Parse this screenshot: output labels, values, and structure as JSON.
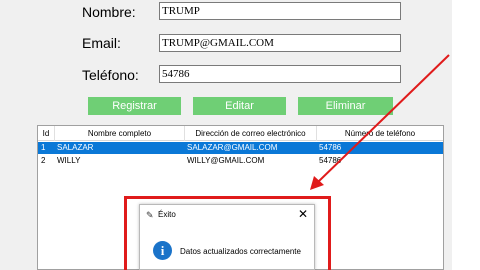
{
  "form": {
    "nombre_label": "Nombre:",
    "nombre_value": "TRUMP",
    "email_label": "Email:",
    "email_value": "TRUMP@GMAIL.COM",
    "telefono_label": "Teléfono:",
    "telefono_value": "54786"
  },
  "buttons": {
    "registrar": "Registrar",
    "editar": "Editar",
    "eliminar": "Eliminar"
  },
  "table": {
    "headers": [
      "Id",
      "Nombre completo",
      "Dirección de correo electrónico",
      "Número de teléfono"
    ],
    "rows": [
      {
        "id": "1",
        "nombre": "SALAZAR",
        "email": "SALAZAR@GMAIL.COM",
        "telefono": "54786",
        "selected": true
      },
      {
        "id": "2",
        "nombre": "WILLY",
        "email": "WILLY@GMAIL.COM",
        "telefono": "54786",
        "selected": false
      }
    ]
  },
  "dialog": {
    "title": "Éxito",
    "message": "Datos actualizados correctamente",
    "icon": "info-icon",
    "close_icon": "close-icon"
  },
  "colors": {
    "button_green": "#6fcf75",
    "selection_blue": "#0a78d7",
    "annotation_red": "#e01b1b",
    "info_blue": "#1a73c9"
  }
}
